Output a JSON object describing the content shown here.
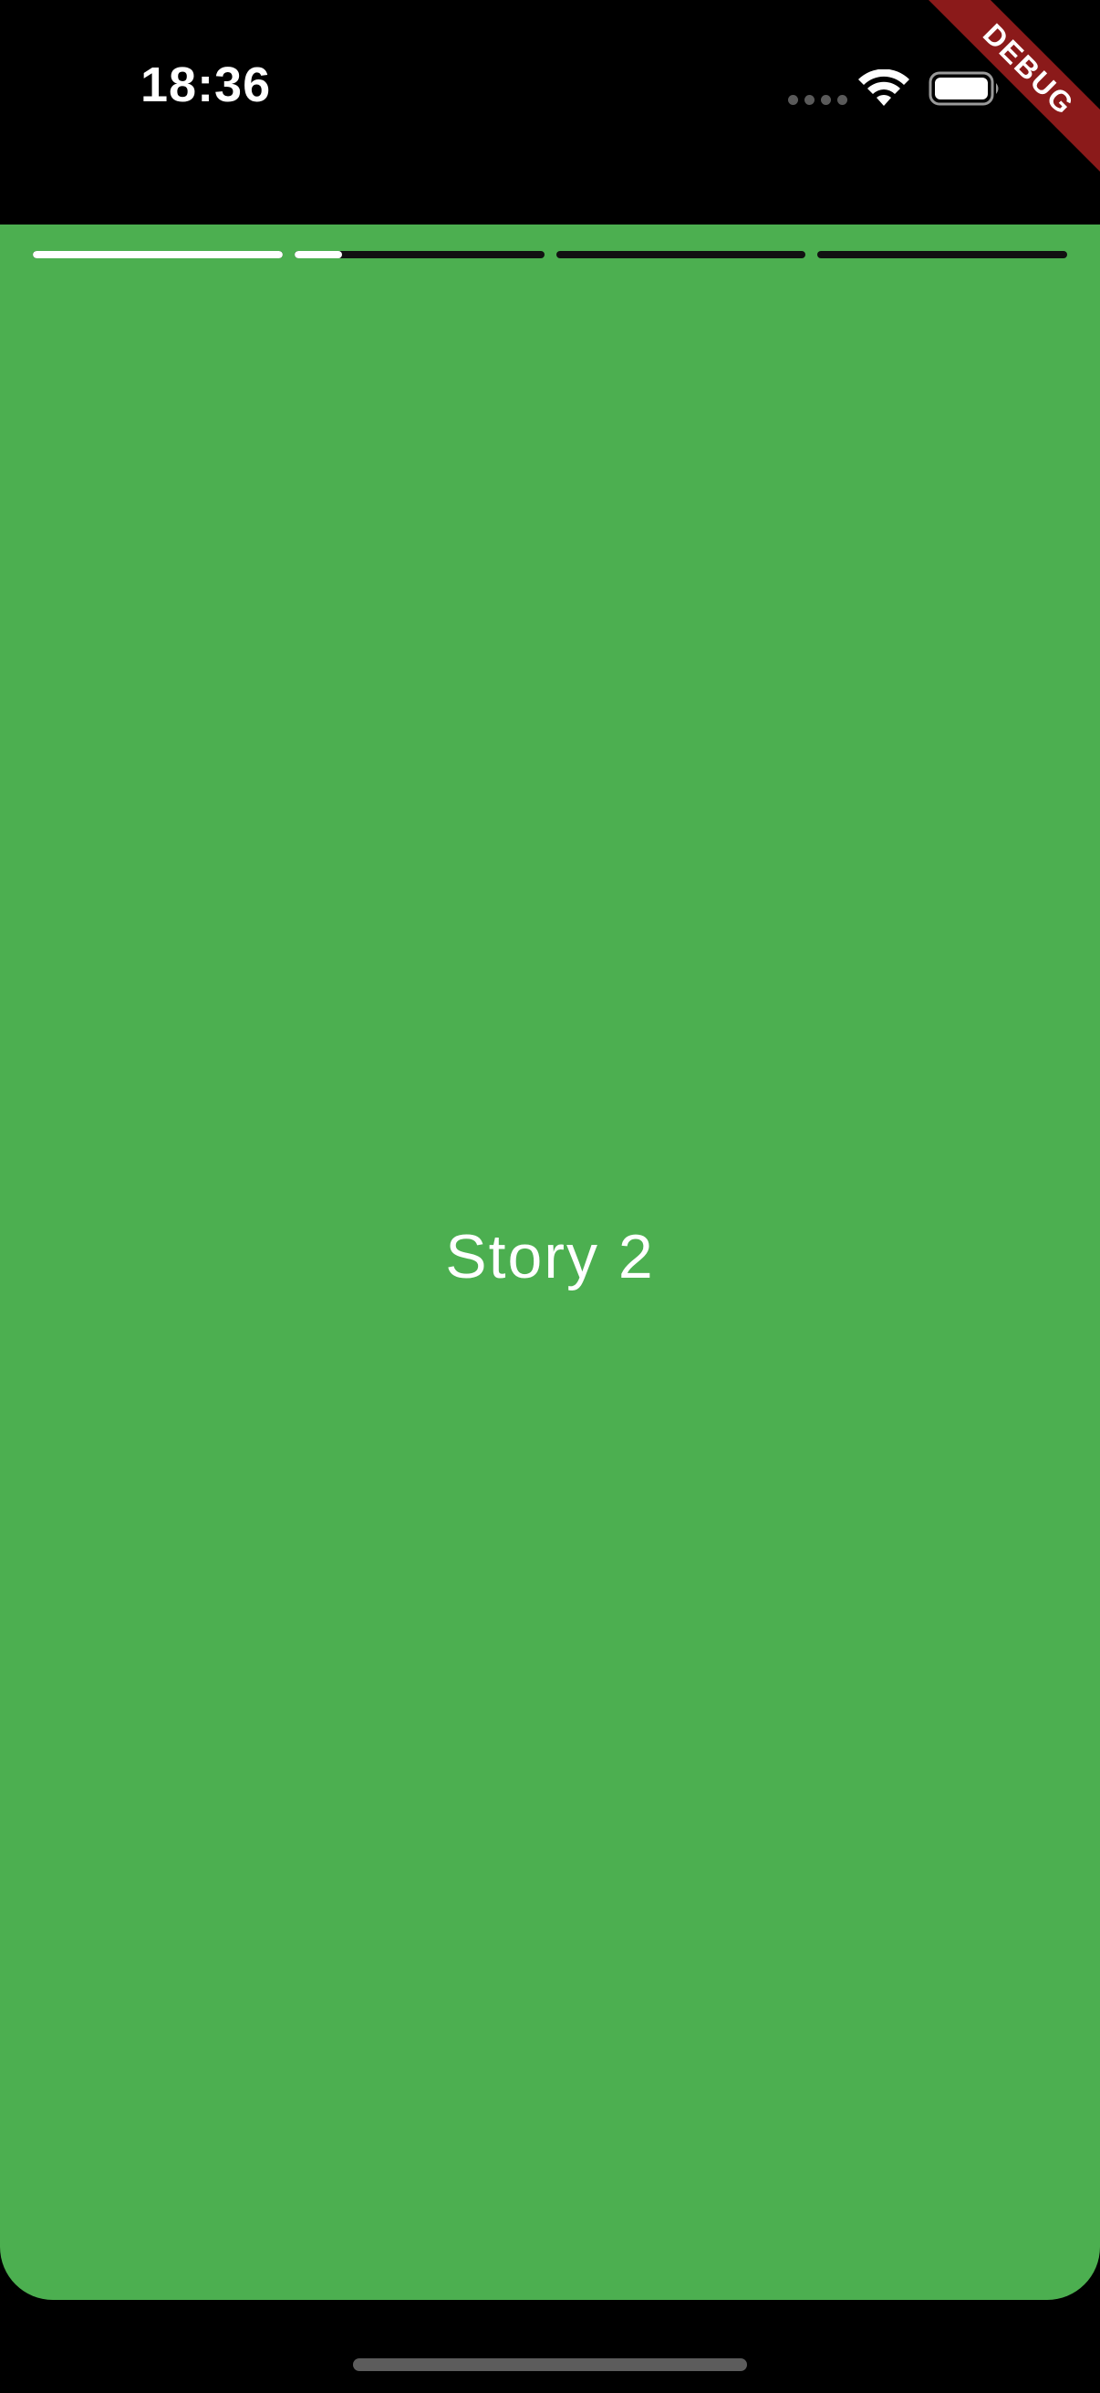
{
  "status_bar": {
    "time": "18:36",
    "icons": [
      "signal-dots-icon",
      "wifi-icon",
      "battery-icon"
    ]
  },
  "debug_banner": {
    "label": "DEBUG",
    "color": "#8b1a1a"
  },
  "story": {
    "title": "Story 2",
    "background_color": "#4caf50",
    "progress": [
      1.0,
      0.19,
      0.0,
      0.0
    ]
  }
}
